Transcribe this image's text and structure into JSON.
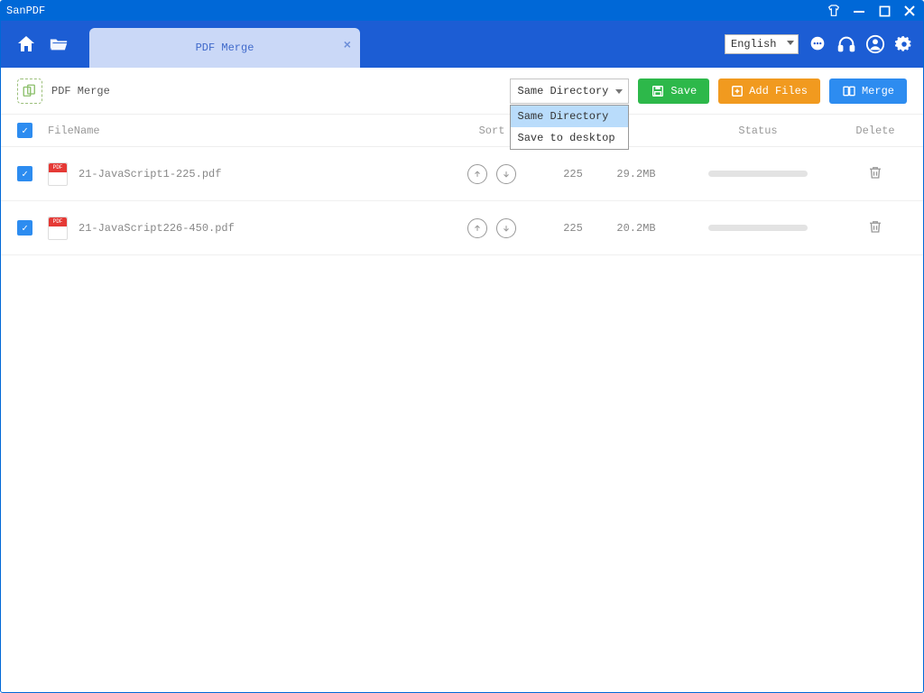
{
  "app": {
    "title": "SanPDF"
  },
  "toolbar": {
    "tab_label": "PDF Merge",
    "language": "English"
  },
  "actionbar": {
    "page_title": "PDF Merge",
    "directory_selected": "Same Directory",
    "directory_options": [
      "Same Directory",
      "Save to desktop"
    ],
    "save_label": "Save",
    "addfiles_label": "Add Files",
    "merge_label": "Merge"
  },
  "columns": {
    "filename": "FileName",
    "sort": "Sort",
    "status": "Status",
    "delete": "Delete"
  },
  "files": [
    {
      "name": "21-JavaScript1-225.pdf",
      "count": "225",
      "size": "29.2MB"
    },
    {
      "name": "21-JavaScript226-450.pdf",
      "count": "225",
      "size": "20.2MB"
    }
  ],
  "colors": {
    "titlebar": "#0068d7",
    "toolbar": "#1c5dd4",
    "accent_blue": "#2d8cf0",
    "accent_green": "#2db84a",
    "accent_orange": "#f19a1f"
  }
}
